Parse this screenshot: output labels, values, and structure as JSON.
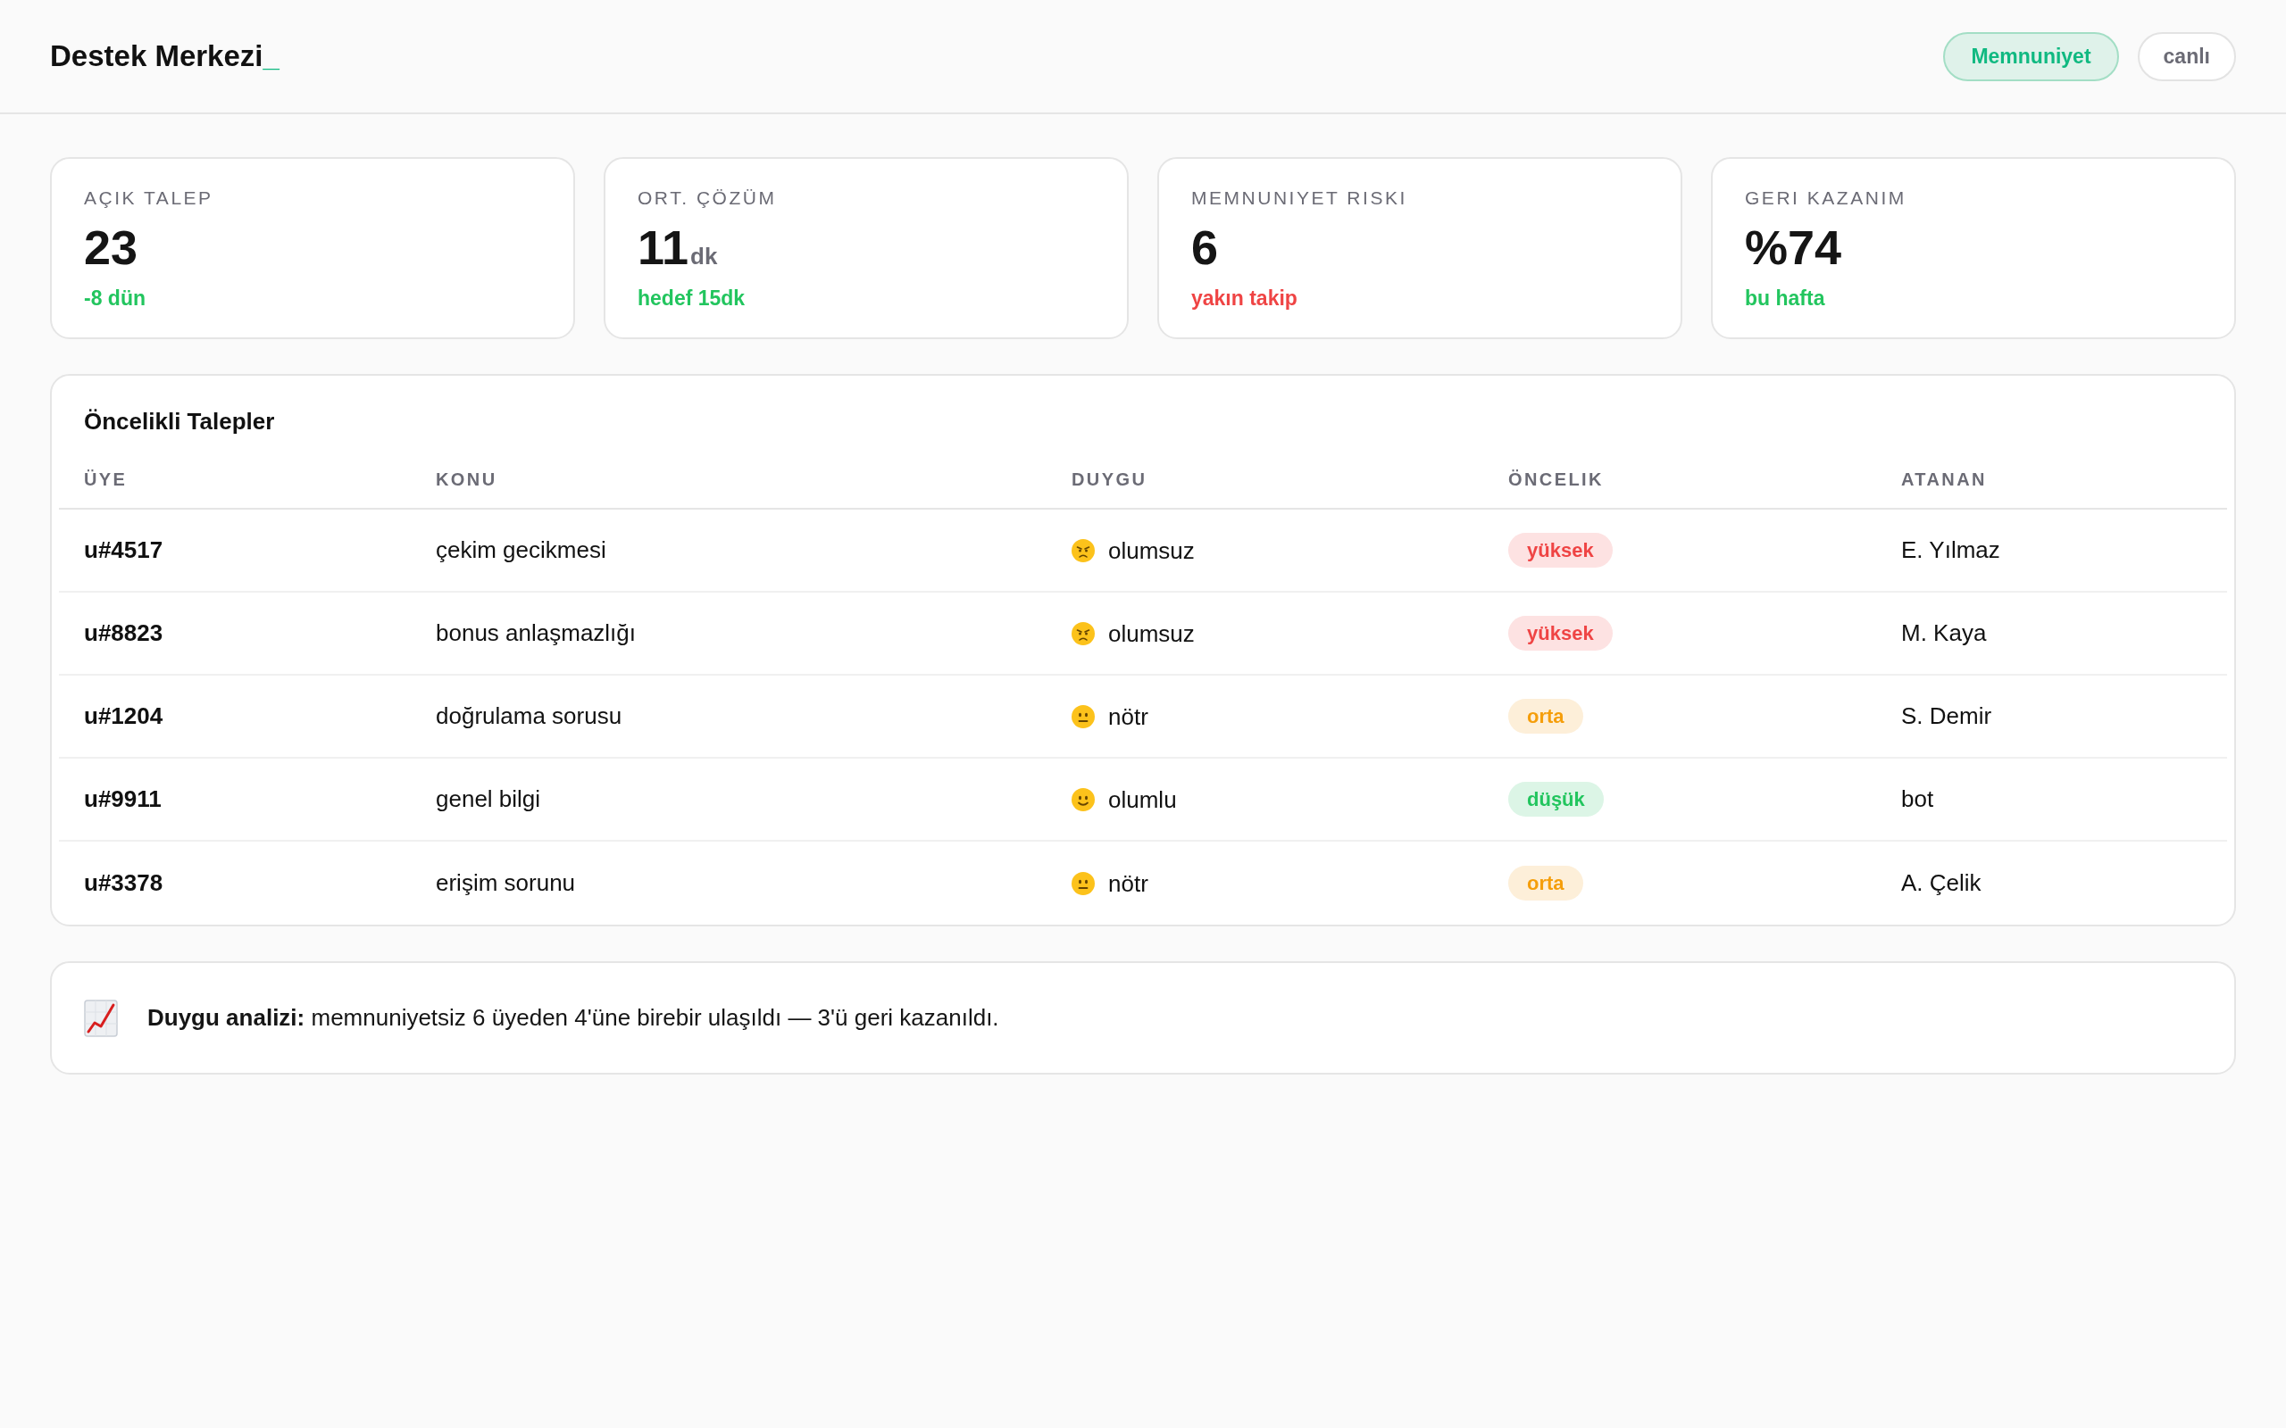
{
  "header": {
    "title": "Destek Merkezi",
    "cursor": "_",
    "chips": [
      {
        "label": "Memnuniyet",
        "selected": true
      },
      {
        "label": "canlı",
        "selected": false
      }
    ]
  },
  "stats": [
    {
      "label": "AÇIK TALEP",
      "value": "23",
      "note": "-8 dün",
      "color": "#22c55e"
    },
    {
      "label": "ORT. ÇÖZÜM",
      "value": "11",
      "unit": "dk",
      "note": "hedef 15dk",
      "color": "#22c55e"
    },
    {
      "label": "MEMNUNIYET RISKI",
      "value": "6",
      "note": "yakın takip",
      "color": "#ef4444"
    },
    {
      "label": "GERI KAZANIM",
      "value": "%74",
      "note": "bu hafta",
      "color": "#22c55e"
    }
  ],
  "table": {
    "title": "Öncelikli Talepler",
    "columns": [
      "ÜYE",
      "KONU",
      "DUYGU",
      "ÖNCELIK",
      "ATANAN"
    ],
    "rows": [
      {
        "member": "u#4517",
        "subject": "çekim gecikmesi",
        "sentiment": {
          "kind": "negative",
          "label": "olumsuz"
        },
        "priority": {
          "kind": "high",
          "label": "yüksek"
        },
        "assignee": "E. Yılmaz"
      },
      {
        "member": "u#8823",
        "subject": "bonus anlaşmazlığı",
        "sentiment": {
          "kind": "negative",
          "label": "olumsuz"
        },
        "priority": {
          "kind": "high",
          "label": "yüksek"
        },
        "assignee": "M. Kaya"
      },
      {
        "member": "u#1204",
        "subject": "doğrulama sorusu",
        "sentiment": {
          "kind": "neutral",
          "label": "nötr"
        },
        "priority": {
          "kind": "medium",
          "label": "orta"
        },
        "assignee": "S. Demir"
      },
      {
        "member": "u#9911",
        "subject": "genel bilgi",
        "sentiment": {
          "kind": "positive",
          "label": "olumlu"
        },
        "priority": {
          "kind": "low",
          "label": "düşük"
        },
        "assignee": "bot"
      },
      {
        "member": "u#3378",
        "subject": "erişim sorunu",
        "sentiment": {
          "kind": "neutral",
          "label": "nötr"
        },
        "priority": {
          "kind": "medium",
          "label": "orta"
        },
        "assignee": "A. Çelik"
      }
    ]
  },
  "insight": {
    "text": "**Duygu analizi:** memnuniyetsiz 6 üyeden 4'üne birebir ulaşıldı — 3'ü geri kazanıldı."
  }
}
